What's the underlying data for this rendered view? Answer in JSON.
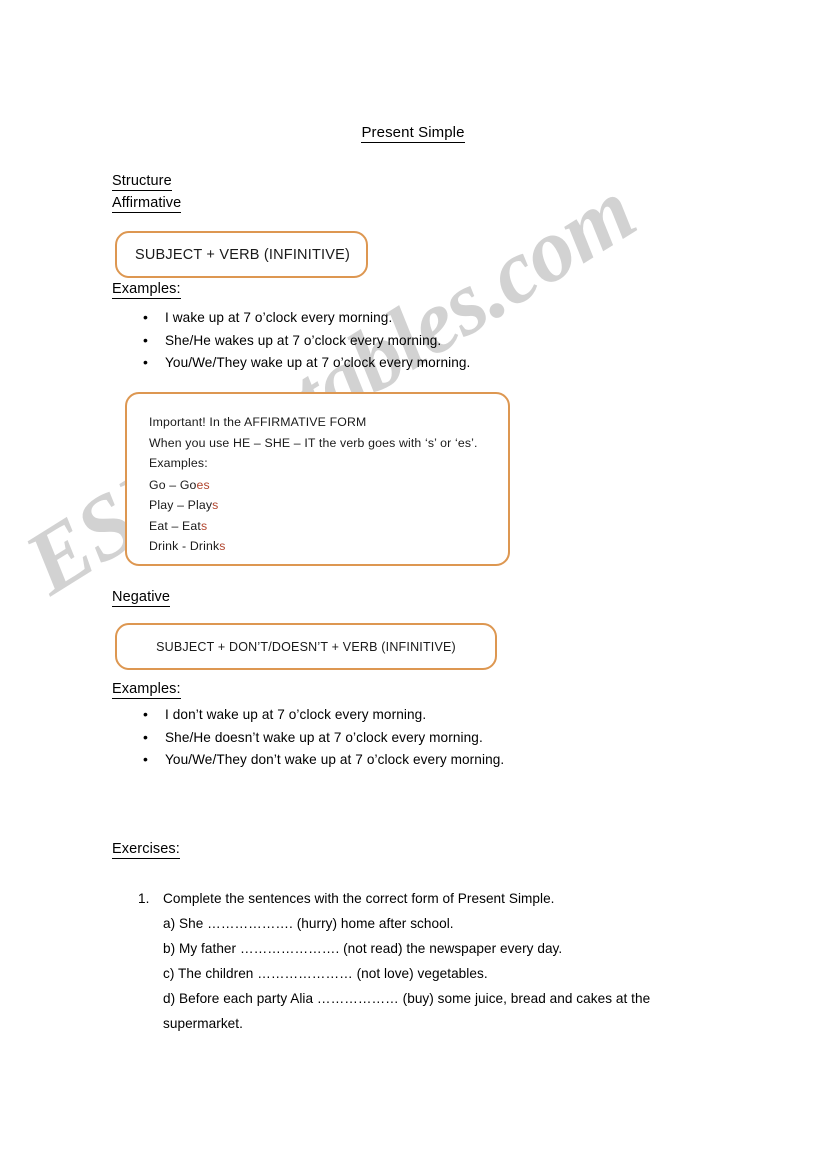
{
  "document": {
    "title": "Present Simple",
    "watermark": "ESLprintables.com",
    "accent_color": "#dd9751",
    "suffix_color": "#b1452e"
  },
  "structure": {
    "heading": "Structure",
    "affirmative_heading": "Affirmative",
    "affirmative_formula": "SUBJECT + VERB (INFINITIVE)",
    "affirmative_examples_label": "Examples:",
    "affirmative_examples": [
      "I wake up at 7 o’clock every morning.",
      "She/He wakes up at 7 o’clock every morning.",
      "You/We/They wake up at 7 o’clock every morning."
    ],
    "negative_heading": "Negative",
    "negative_formula": "SUBJECT + DON’T/DOESN’T + VERB (INFINITIVE)",
    "negative_examples_label": "Examples:",
    "negative_examples": [
      "I don’t wake up at 7 o’clock every morning.",
      "She/He doesn’t wake up at 7 o’clock every morning.",
      "You/We/They don’t wake up at 7 o’clock every morning."
    ]
  },
  "important_box": {
    "line1": "Important! In the AFFIRMATIVE FORM",
    "line2": "When you use HE – SHE – IT the verb goes with ‘s’ or ‘es’.",
    "line3": "Examples:",
    "verbs": [
      {
        "base": "Go – Go",
        "suffix": "es"
      },
      {
        "base": "Play – Play",
        "suffix": "s"
      },
      {
        "base": "Eat – Eat",
        "suffix": "s"
      },
      {
        "base": "Drink - Drink",
        "suffix": "s"
      }
    ]
  },
  "exercises": {
    "heading": "Exercises:",
    "items": [
      {
        "number": "1.",
        "prompt": "Complete the sentences with the correct form of Present Simple.",
        "subitems": [
          "a) She ………………. (hurry)  home after school.",
          "b) My father …………………. (not read)  the newspaper every day.",
          "c) The children ………………… (not love)   vegetables.",
          "d) Before each party Alia ……………… (buy) some juice, bread and cakes at the supermarket."
        ]
      }
    ]
  }
}
